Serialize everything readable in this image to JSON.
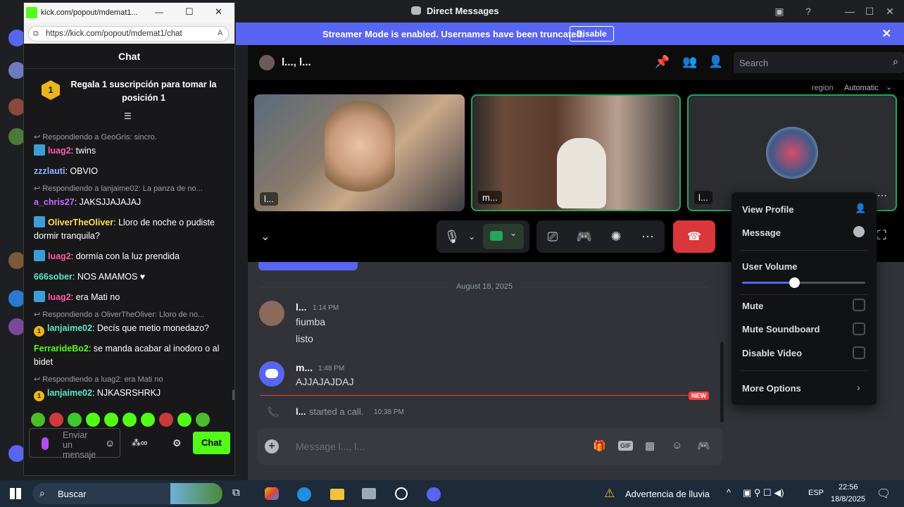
{
  "titlebar": {
    "title": "Direct Messages"
  },
  "banner": {
    "message": "Streamer Mode is enabled. Usernames have been truncated.",
    "disable_label": "Disable"
  },
  "call": {
    "header_name": "l..., l...",
    "search_placeholder": "Search",
    "region_label": "region",
    "region_value": "Automatic",
    "tiles": [
      {
        "name": "l..."
      },
      {
        "name": "m..."
      },
      {
        "name": "l..."
      }
    ]
  },
  "chat_log": {
    "date_divider": "August 18, 2025",
    "messages": [
      {
        "author": "l...",
        "time": "1:14 PM",
        "lines": [
          "fiumba",
          "listo"
        ]
      },
      {
        "author": "m...",
        "time": "1:48 PM",
        "lines": [
          "AJJAJAJDAJ"
        ]
      }
    ],
    "system": {
      "author": "l...",
      "text": "started a call.",
      "time": "10:38 PM"
    },
    "new_badge": "NEW",
    "composer_placeholder": "Message l..., l..."
  },
  "context_menu": {
    "view_profile": "View Profile",
    "message": "Message",
    "user_volume": "User Volume",
    "volume_level": 0.42,
    "mute": "Mute",
    "mute_soundboard": "Mute Soundboard",
    "disable_video": "Disable Video",
    "more_options": "More Options"
  },
  "kick": {
    "window_title": "kick.com/popout/mdemat1...",
    "url": "https://kick.com/popout/mdemat1/chat",
    "chat_title": "Chat",
    "gift_badge": "1",
    "gift_text": "Regala 1 suscripción para tomar la posición 1",
    "lines": [
      {
        "reply": "Respondiendo a GeoGris: sincro."
      },
      {
        "user": "luag2",
        "color": "#ff5ca8",
        "badge": "blue",
        "text": "twins"
      },
      {
        "user": "zzzlauti",
        "color": "#8ab4ff",
        "text": "OBVIO"
      },
      {
        "reply": "Respondiendo a lanjaime02: La panza de no..."
      },
      {
        "user": "a_chris27",
        "color": "#c46cff",
        "text": "JAKSJJAJAJAJ"
      },
      {
        "user": "OliverTheOliver",
        "color": "#ffdf57",
        "badge": "blue",
        "text": "Lloro de noche o pudiste dormir tranquila?"
      },
      {
        "user": "luag2",
        "color": "#ff5ca8",
        "badge": "blue",
        "text": "dormía con la luz prendida"
      },
      {
        "user": "666sober",
        "color": "#5ee7c4",
        "text": "NOS AMAMOS ♥"
      },
      {
        "user": "luag2",
        "color": "#ff5ca8",
        "badge": "blue",
        "text": "era Mati no"
      },
      {
        "reply": "Respondiendo a OliverTheOliver: Lloro de no..."
      },
      {
        "user": "lanjaime02",
        "color": "#5ee7c4",
        "badge": "coin",
        "text": "Decís que metio monedazo?"
      },
      {
        "user": "FerrarideBo2",
        "color": "#53fc18",
        "text": "se manda acabar al inodoro o al bidet"
      },
      {
        "reply": "Respondiendo a luag2: era Mati no"
      },
      {
        "user": "lanjaime02",
        "color": "#5ee7c4",
        "badge": "coin",
        "text": "NJKASRSHRKJ"
      }
    ],
    "input_placeholder": "Enviar un mensaje",
    "send_label": "Chat"
  },
  "taskbar": {
    "search_label": "Buscar",
    "weather": "Advertencia de lluvia",
    "lang": "ESP",
    "time": "22:56",
    "date": "18/8/2025"
  },
  "colors": {
    "blurple": "#5865f2",
    "kick_green": "#53fc18",
    "danger": "#da373c"
  }
}
